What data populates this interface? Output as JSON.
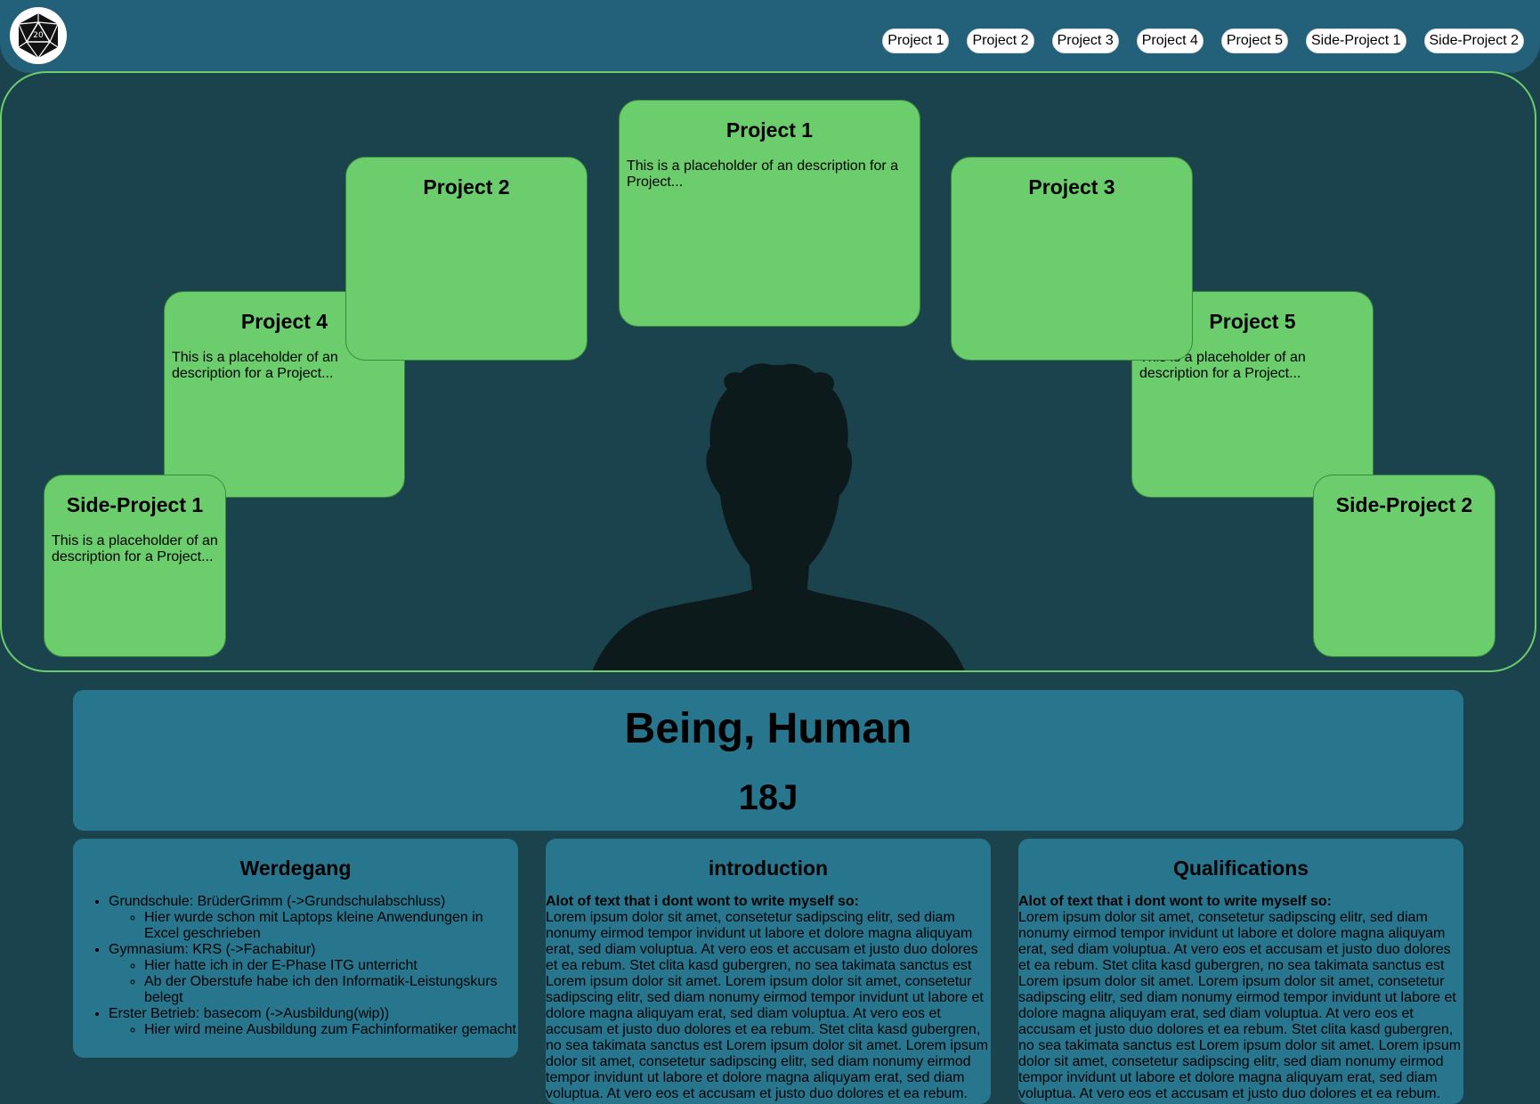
{
  "nav": {
    "items": [
      "Project 1",
      "Project 2",
      "Project 3",
      "Project 4",
      "Project 5",
      "Side-Project 1",
      "Side-Project 2"
    ]
  },
  "projects": {
    "p1": {
      "title": "Project 1",
      "desc": "This is a placeholder of an description for a Project..."
    },
    "p2": {
      "title": "Project 2",
      "desc": ""
    },
    "p3": {
      "title": "Project 3",
      "desc": ""
    },
    "p4": {
      "title": "Project 4",
      "desc": "This is a placeholder of an description for a Project..."
    },
    "p5": {
      "title": "Project 5",
      "desc": "This is a placeholder of an description for a Project..."
    },
    "s1": {
      "title": "Side-Project 1",
      "desc": "This is a placeholder of an description for a Project..."
    },
    "s2": {
      "title": "Side-Project 2",
      "desc": ""
    }
  },
  "profile": {
    "name": "Being, Human",
    "age": "18J"
  },
  "werdegang": {
    "title": "Werdegang",
    "items": [
      {
        "text": "Grundschule: BrüderGrimm (->Grundschulabschluss)",
        "sub": [
          "Hier wurde schon mit Laptops kleine Anwendungen in Excel geschrieben"
        ]
      },
      {
        "text": "Gymnasium: KRS (->Fachabitur)",
        "sub": [
          "Hier hatte ich in der E-Phase ITG unterricht",
          "Ab der Oberstufe habe ich den Informatik-Leistungskurs belegt"
        ]
      },
      {
        "text": "Erster Betrieb: basecom (->Ausbildung(wip))",
        "sub": [
          "Hier wird meine Ausbildung zum Fachinformatiker gemacht"
        ]
      }
    ]
  },
  "introduction": {
    "title": "introduction",
    "lead": "Alot of text that i dont wont to write myself so:",
    "body": "Lorem ipsum dolor sit amet, consetetur sadipscing elitr, sed diam nonumy eirmod tempor invidunt ut labore et dolore magna aliquyam erat, sed diam voluptua. At vero eos et accusam et justo duo dolores et ea rebum. Stet clita kasd gubergren, no sea takimata sanctus est Lorem ipsum dolor sit amet. Lorem ipsum dolor sit amet, consetetur sadipscing elitr, sed diam nonumy eirmod tempor invidunt ut labore et dolore magna aliquyam erat, sed diam voluptua. At vero eos et accusam et justo duo dolores et ea rebum. Stet clita kasd gubergren, no sea takimata sanctus est Lorem ipsum dolor sit amet. Lorem ipsum dolor sit amet, consetetur sadipscing elitr, sed diam nonumy eirmod tempor invidunt ut labore et dolore magna aliquyam erat, sed diam voluptua. At vero eos et accusam et justo duo dolores et ea rebum."
  },
  "qualifications": {
    "title": "Qualifications",
    "lead": "Alot of text that i dont wont to write myself so:",
    "body": "Lorem ipsum dolor sit amet, consetetur sadipscing elitr, sed diam nonumy eirmod tempor invidunt ut labore et dolore magna aliquyam erat, sed diam voluptua. At vero eos et accusam et justo duo dolores et ea rebum. Stet clita kasd gubergren, no sea takimata sanctus est Lorem ipsum dolor sit amet. Lorem ipsum dolor sit amet, consetetur sadipscing elitr, sed diam nonumy eirmod tempor invidunt ut labore et dolore magna aliquyam erat, sed diam voluptua. At vero eos et accusam et justo duo dolores et ea rebum. Stet clita kasd gubergren, no sea takimata sanctus est Lorem ipsum dolor sit amet. Lorem ipsum dolor sit amet, consetetur sadipscing elitr, sed diam nonumy eirmod tempor invidunt ut labore et dolore magna aliquyam erat, sed diam voluptua. At vero eos et accusam et justo duo dolores et ea rebum."
  },
  "colors": {
    "background": "#1b434d",
    "header": "#236079",
    "panel": "#27768e",
    "card": "#6bcd6b"
  },
  "icons": {
    "logo": "d20-dice-icon",
    "portrait": "person-silhouette-icon"
  }
}
